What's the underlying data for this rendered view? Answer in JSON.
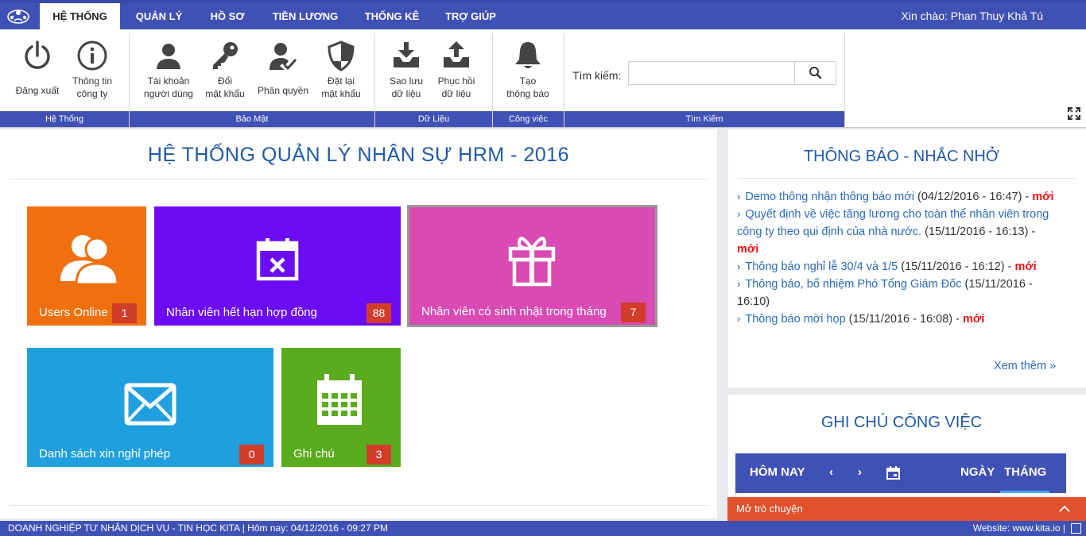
{
  "nav": {
    "tabs": [
      "HỆ THỐNG",
      "QUẢN LÝ",
      "HỒ SƠ",
      "TIỀN LƯƠNG",
      "THỐNG KÊ",
      "TRỢ GIÚP"
    ],
    "greeting": "Xin chào: Phan Thuy Khả Tú"
  },
  "ribbon": {
    "logout": "Đăng xuất",
    "company_info": [
      "Thông tin",
      "công ty"
    ],
    "user_accounts": [
      "Tài khoản",
      "người dùng"
    ],
    "change_password": [
      "Đổi",
      "mật khẩu"
    ],
    "permissions": "Phân quyền",
    "reset_password": [
      "Đặt lại",
      "mật khẩu"
    ],
    "backup": [
      "Sao lưu",
      "dữ liệu"
    ],
    "restore": [
      "Phục hồi",
      "dữ liệu"
    ],
    "create_notice": [
      "Tạo",
      "thông báo"
    ],
    "search_label": "Tìm kiếm:",
    "search_value": "",
    "groups": {
      "system": "Hệ Thống",
      "security": "Bảo Mật",
      "data": "Dữ Liệu",
      "work": "Công việc",
      "search": "Tìm Kiếm"
    }
  },
  "main": {
    "title": "HỆ THỐNG QUẢN LÝ NHÂN SỰ HRM - 2016",
    "tiles": [
      {
        "label": "Users Online",
        "count": "1",
        "color": "#f07010"
      },
      {
        "label": "Nhân viên hết hạn hợp đồng",
        "count": "88",
        "color": "#6b0cf5"
      },
      {
        "label": "Nhân viên có sinh nhật trong tháng",
        "count": "7",
        "color": "#d94bb3"
      },
      {
        "label": "Danh sách xin nghỉ phép",
        "count": "0",
        "color": "#1f9fde"
      },
      {
        "label": "Ghi chú",
        "count": "3",
        "color": "#5aab1d"
      }
    ]
  },
  "notice": {
    "title": "THÔNG BÁO - NHẮC NHỞ",
    "items": [
      {
        "link": "Demo thông nhận thông báo mới",
        "meta": " (04/12/2016 - 16:47) - ",
        "new": "mới"
      },
      {
        "link": "Quyết định về việc tăng lương cho toàn thể nhân viên trong công ty theo qui định của nhà nước.",
        "meta": " (15/11/2016 - 16:13) - ",
        "new": "mới"
      },
      {
        "link": "Thông báo nghỉ lễ 30/4 và 1/5",
        "meta": " (15/11/2016 - 16:12) - ",
        "new": "mới"
      },
      {
        "link": "Thông báo, bổ nhiệm Phó Tổng Giám Đốc",
        "meta": " (15/11/2016 - 16:10)",
        "new": ""
      },
      {
        "link": "Thông báo mời họp",
        "meta": " (15/11/2016 - 16:08) - ",
        "new": "mới"
      }
    ],
    "more": "Xem thêm"
  },
  "notes": {
    "title": "GHI CHÚ CÔNG VIỆC",
    "today": "HÔM NAY",
    "day": "NGÀY",
    "month": "THÁNG"
  },
  "chat": {
    "label": "Mở trò chuyện"
  },
  "footer": {
    "left": "DOANH NGHIỆP TƯ NHÂN DỊCH VỤ - TIN HỌC KITA | Hôm nay: 04/12/2016 - 09:27 PM",
    "right": "Website: www.kita.io |"
  }
}
